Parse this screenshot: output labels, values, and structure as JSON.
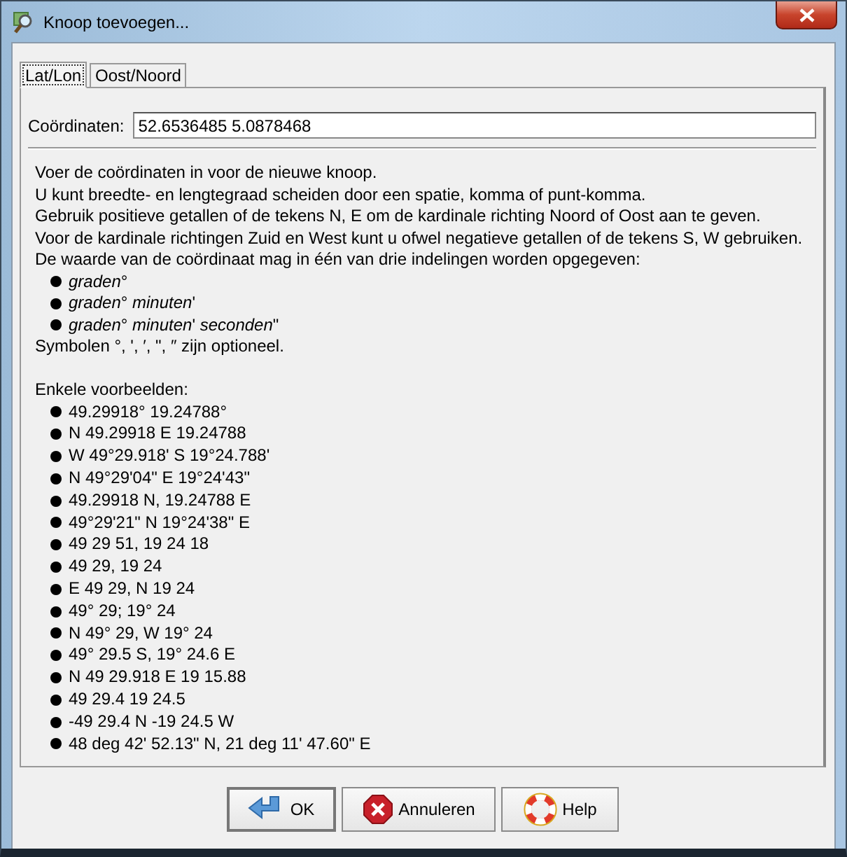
{
  "window": {
    "title": "Knoop toevoegen..."
  },
  "tabs": [
    {
      "label": "Lat/Lon",
      "selected": true
    },
    {
      "label": "Oost/Noord",
      "selected": false
    }
  ],
  "coordinates": {
    "label": "Coördinaten:",
    "value": "52.6536485 5.0878468"
  },
  "intro": [
    "Voer de coördinaten in voor de nieuwe knoop.",
    "U kunt breedte- en lengtegraad scheiden door een spatie, komma of punt-komma.",
    "Gebruik positieve getallen of de tekens N, E om de kardinale richting Noord of Oost aan te geven.",
    "Voor de kardinale richtingen Zuid en West kunt u ofwel negatieve getallen of de tekens S, W gebruiken.",
    "De waarde van de coördinaat mag in één van drie indelingen worden opgegeven:"
  ],
  "formats": [
    "*graden*°",
    "*graden*° *minuten*'",
    "*graden*° *minuten*' *seconden*\""
  ],
  "symbols_note": "Symbolen °, ', ′, \", ″ zijn optioneel.",
  "examples_heading": "Enkele voorbeelden:",
  "examples": [
    "49.29918° 19.24788°",
    "N 49.29918 E 19.24788",
    "W 49°29.918' S 19°24.788'",
    "N 49°29'04\" E 19°24'43\"",
    "49.29918 N, 19.24788 E",
    "49°29'21\" N 19°24'38\" E",
    "49 29 51, 19 24 18",
    "49 29, 19 24",
    "E 49 29, N 19 24",
    "49° 29; 19° 24",
    "N 49° 29, W 19° 24",
    "49° 29.5 S, 19° 24.6 E",
    "N 49 29.918 E 19 15.88",
    "49 29.4 19 24.5",
    "-49 29.4 N -19 24.5 W",
    "48 deg 42' 52.13\" N, 21 deg 11' 47.60\" E"
  ],
  "buttons": [
    {
      "kind": "ok",
      "label": "OK"
    },
    {
      "kind": "cancel",
      "label": "Annuleren"
    },
    {
      "kind": "help",
      "label": "Help"
    }
  ]
}
